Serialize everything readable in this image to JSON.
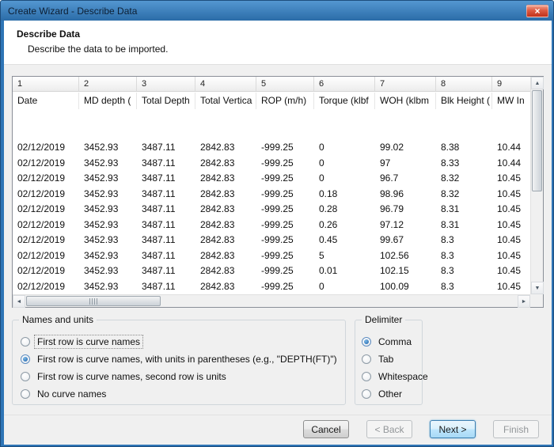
{
  "window": {
    "title": "Create Wizard - Describe Data"
  },
  "icons": {
    "close": "×",
    "up": "▲",
    "down": "▼",
    "left": "◄",
    "right": "►"
  },
  "header": {
    "title": "Describe Data",
    "subtitle": "Describe the data to be imported."
  },
  "grid": {
    "index_headers": [
      "1",
      "2",
      "3",
      "4",
      "5",
      "6",
      "7",
      "8",
      "9"
    ],
    "column_headers": [
      "Date",
      "MD depth (",
      "Total Depth",
      "Total Vertica",
      "ROP (m/h)",
      "Torque (klbf",
      "WOH (klbm",
      "Blk Height (",
      "MW In"
    ],
    "empty_row_count": 2,
    "rows": [
      [
        "02/12/2019",
        "3452.93",
        "3487.11",
        "2842.83",
        "-999.25",
        "0",
        "99.02",
        "8.38",
        "10.44"
      ],
      [
        "02/12/2019",
        "3452.93",
        "3487.11",
        "2842.83",
        "-999.25",
        "0",
        "97",
        "8.33",
        "10.44"
      ],
      [
        "02/12/2019",
        "3452.93",
        "3487.11",
        "2842.83",
        "-999.25",
        "0",
        "96.7",
        "8.32",
        "10.45"
      ],
      [
        "02/12/2019",
        "3452.93",
        "3487.11",
        "2842.83",
        "-999.25",
        "0.18",
        "98.96",
        "8.32",
        "10.45"
      ],
      [
        "02/12/2019",
        "3452.93",
        "3487.11",
        "2842.83",
        "-999.25",
        "0.28",
        "96.79",
        "8.31",
        "10.45"
      ],
      [
        "02/12/2019",
        "3452.93",
        "3487.11",
        "2842.83",
        "-999.25",
        "0.26",
        "97.12",
        "8.31",
        "10.45"
      ],
      [
        "02/12/2019",
        "3452.93",
        "3487.11",
        "2842.83",
        "-999.25",
        "0.45",
        "99.67",
        "8.3",
        "10.45"
      ],
      [
        "02/12/2019",
        "3452.93",
        "3487.11",
        "2842.83",
        "-999.25",
        "5",
        "102.56",
        "8.3",
        "10.45"
      ],
      [
        "02/12/2019",
        "3452.93",
        "3487.11",
        "2842.83",
        "-999.25",
        "0.01",
        "102.15",
        "8.3",
        "10.45"
      ],
      [
        "02/12/2019",
        "3452.93",
        "3487.11",
        "2842.83",
        "-999.25",
        "0",
        "100.09",
        "8.3",
        "10.45"
      ]
    ]
  },
  "names_and_units": {
    "title": "Names and units",
    "options": [
      {
        "label": "First row is curve names",
        "selected": false,
        "focused": true
      },
      {
        "label": "First row is curve names, with units in parentheses (e.g., \"DEPTH(FT)\")",
        "selected": true,
        "focused": false
      },
      {
        "label": "First row is curve names, second row is units",
        "selected": false,
        "focused": false
      },
      {
        "label": "No curve names",
        "selected": false,
        "focused": false
      }
    ]
  },
  "delimiter": {
    "title": "Delimiter",
    "options": [
      {
        "label": "Comma",
        "selected": true,
        "focused": false
      },
      {
        "label": "Tab",
        "selected": false,
        "focused": false
      },
      {
        "label": "Whitespace",
        "selected": false,
        "focused": false
      },
      {
        "label": "Other",
        "selected": false,
        "focused": false
      }
    ]
  },
  "footer": {
    "buttons": [
      {
        "label": "Cancel",
        "state": "normal"
      },
      {
        "label": "< Back",
        "state": "disabled"
      },
      {
        "label": "Next >",
        "state": "default"
      },
      {
        "label": "Finish",
        "state": "disabled"
      }
    ]
  }
}
